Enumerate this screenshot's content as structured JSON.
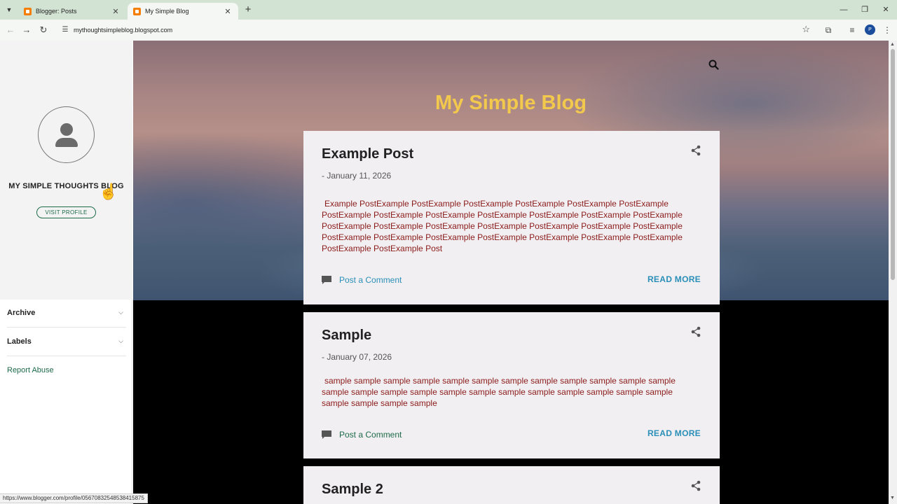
{
  "browser": {
    "tabs": [
      {
        "title": "Blogger: Posts",
        "active": false
      },
      {
        "title": "My Simple Blog",
        "active": true
      }
    ],
    "url": "mythoughtsimpleblog.blogspot.com",
    "profile_initial": "P",
    "status_url": "https://www.blogger.com/profile/05670832548538415875"
  },
  "sidebar": {
    "blog_name": "MY SIMPLE THOUGHTS BLOG",
    "visit_profile": "VISIT PROFILE",
    "widgets": [
      {
        "label": "Archive"
      },
      {
        "label": "Labels"
      }
    ],
    "report_abuse": "Report Abuse"
  },
  "header": {
    "title": "My Simple Blog"
  },
  "posts": [
    {
      "title": "Example Post",
      "date": "- January 11, 2026",
      "body": "Example PostExample PostExample PostExample PostExample PostExample PostExample PostExample PostExample PostExample PostExample PostExample PostExample PostExample PostExample PostExample PostExample PostExample PostExample PostExample PostExample PostExample PostExample PostExample PostExample PostExample PostExample PostExample PostExample PostExample Post",
      "comment_label": "Post a Comment",
      "read_more": "READ MORE"
    },
    {
      "title": "Sample",
      "date": "- January 07, 2026",
      "body": "sample sample sample sample sample sample sample sample sample sample sample sample sample sample sample sample sample sample sample sample sample sample sample sample sample sample sample sample",
      "comment_label": "Post a Comment",
      "read_more": "READ MORE"
    },
    {
      "title": "Sample 2"
    }
  ],
  "colors": {
    "accent_title": "#f2c94c",
    "post_body": "#8b1a1a",
    "comment_link_first": "#2a8fb8",
    "comment_link_second": "#1e6b4a",
    "read_more": "#2a8fb8",
    "sidebar_link": "#1e6b4a"
  },
  "icons": {
    "tab_favicon": "blogger-icon",
    "search": "search-icon",
    "share": "share-icon",
    "comment": "comment-icon"
  }
}
